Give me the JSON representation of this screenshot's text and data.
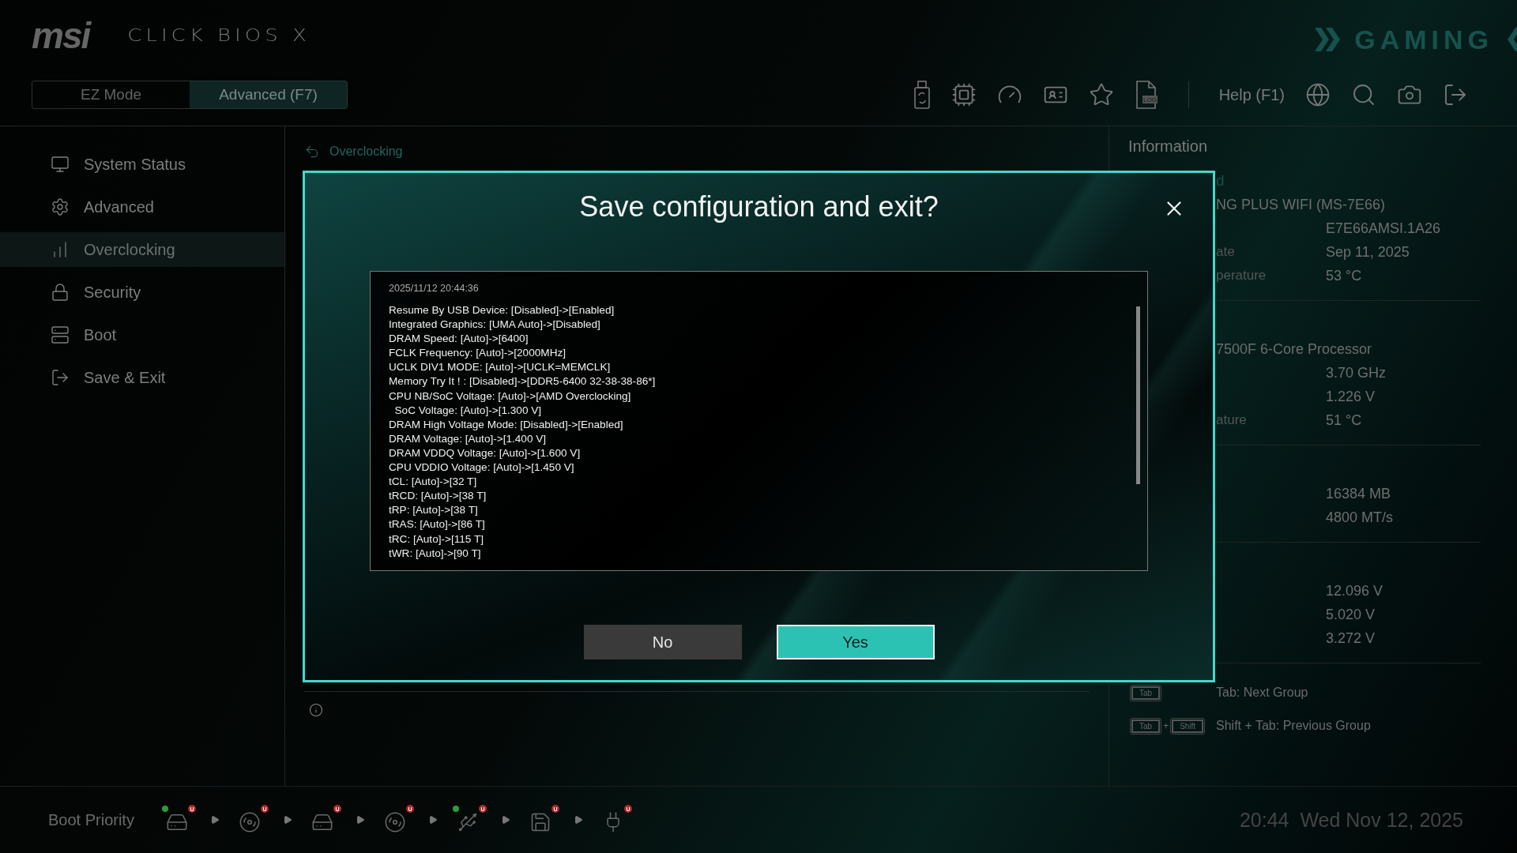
{
  "header": {
    "brand": "msi",
    "product": "CLICK BIOS X",
    "edition": "GAMING",
    "modes": [
      {
        "label": "EZ Mode",
        "selected": false
      },
      {
        "label": "Advanced (F7)",
        "selected": true
      }
    ],
    "tools": [
      {
        "kind": "usb"
      },
      {
        "kind": "cpu"
      },
      {
        "kind": "gauge"
      },
      {
        "kind": "card"
      },
      {
        "kind": "star"
      },
      {
        "kind": "log",
        "label": "LOG"
      }
    ],
    "help": "Help (F1)",
    "actions": [
      {
        "kind": "globe"
      },
      {
        "kind": "search"
      },
      {
        "kind": "camera"
      },
      {
        "kind": "exit"
      }
    ]
  },
  "sidebar": {
    "items": [
      {
        "label": "System Status",
        "kind": "monitor",
        "selected": false
      },
      {
        "label": "Advanced",
        "kind": "gear",
        "selected": false
      },
      {
        "label": "Overclocking",
        "kind": "chart",
        "selected": true
      },
      {
        "label": "Security",
        "kind": "lock",
        "selected": false
      },
      {
        "label": "Boot",
        "kind": "server",
        "selected": false
      },
      {
        "label": "Save & Exit",
        "kind": "exit",
        "selected": false
      }
    ]
  },
  "breadcrumb": "Overclocking",
  "dialog": {
    "title": "Save configuration and exit?",
    "log": {
      "timestamp": "2025/11/12 20:44:36",
      "lines": [
        "Resume By USB Device: [Disabled]->[Enabled]",
        "Integrated Graphics: [UMA Auto]->[Disabled]",
        "DRAM Speed: [Auto]->[6400]",
        "FCLK Frequency: [Auto]->[2000MHz]",
        "UCLK DIV1 MODE: [Auto]->[UCLK=MEMCLK]",
        "Memory Try It ! : [Disabled]->[DDR5-6400 32-38-38-86*]",
        "CPU NB/SoC Voltage: [Auto]->[AMD Overclocking]",
        "  SoC Voltage: [Auto]->[1.300 V]",
        "DRAM High Voltage Mode: [Disabled]->[Enabled]",
        "DRAM Voltage: [Auto]->[1.400 V]",
        "DRAM VDDQ Voltage: [Auto]->[1.600 V]",
        "CPU VDDIO Voltage: [Auto]->[1.450 V]",
        "tCL: [Auto]->[32 T]",
        "tRCD: [Auto]->[38 T]",
        "tRP: [Auto]->[38 T]",
        "tRAS: [Auto]->[86 T]",
        "tRC: [Auto]->[115 T]",
        "tWR: [Auto]->[90 T]"
      ]
    },
    "buttons": [
      {
        "label": "No",
        "selected": false
      },
      {
        "label": "Yes",
        "selected": true
      }
    ]
  },
  "information": {
    "title": "Information",
    "groups": [
      {
        "heading": "d",
        "subtitle": "NG PLUS WIFI (MS-7E66)",
        "rows": [
          {
            "value": "E7E66AMSI.1A26"
          },
          {
            "label": "ate",
            "value": "Sep 11, 2025"
          },
          {
            "label": "perature",
            "value": "53 °C"
          }
        ]
      },
      {
        "subtitle": "7500F 6-Core Processor",
        "rows": [
          {
            "value": "3.70 GHz"
          },
          {
            "value": "1.226 V"
          },
          {
            "label": "ature",
            "value": "51 °C"
          }
        ]
      },
      {
        "rows": [
          {
            "value": "16384 MB"
          },
          {
            "value": "4800 MT/s"
          }
        ]
      },
      {
        "rows": [
          {
            "value": "12.096 V"
          },
          {
            "value": "5.020 V"
          },
          {
            "value": "3.272 V"
          }
        ]
      }
    ],
    "hints": [
      {
        "keys": [
          {
            "kind": "key",
            "label": "Tab"
          }
        ],
        "text": "Tab: Next Group"
      },
      {
        "keys": [
          {
            "kind": "key",
            "label": "Tab"
          },
          {
            "kind": "joiner",
            "label": "+"
          },
          {
            "kind": "key",
            "label": "Shift"
          }
        ],
        "text": "Shift + Tab: Previous Group"
      }
    ]
  },
  "boot_priority": {
    "label": "Boot Priority",
    "devices": [
      {
        "kind": "disk",
        "badge": "U",
        "ready": true
      },
      {
        "kind": "disc",
        "badge": "U",
        "ready": false
      },
      {
        "kind": "disk",
        "badge": "U",
        "ready": false
      },
      {
        "kind": "disc",
        "badge": "U",
        "ready": false
      },
      {
        "kind": "usb",
        "badge": "U",
        "ready": true
      },
      {
        "kind": "floppy",
        "badge": "U",
        "ready": false
      },
      {
        "kind": "plug",
        "badge": "U",
        "ready": false
      }
    ]
  },
  "clock": {
    "time": "20:44",
    "date": "Wed Nov 12, 2025"
  }
}
